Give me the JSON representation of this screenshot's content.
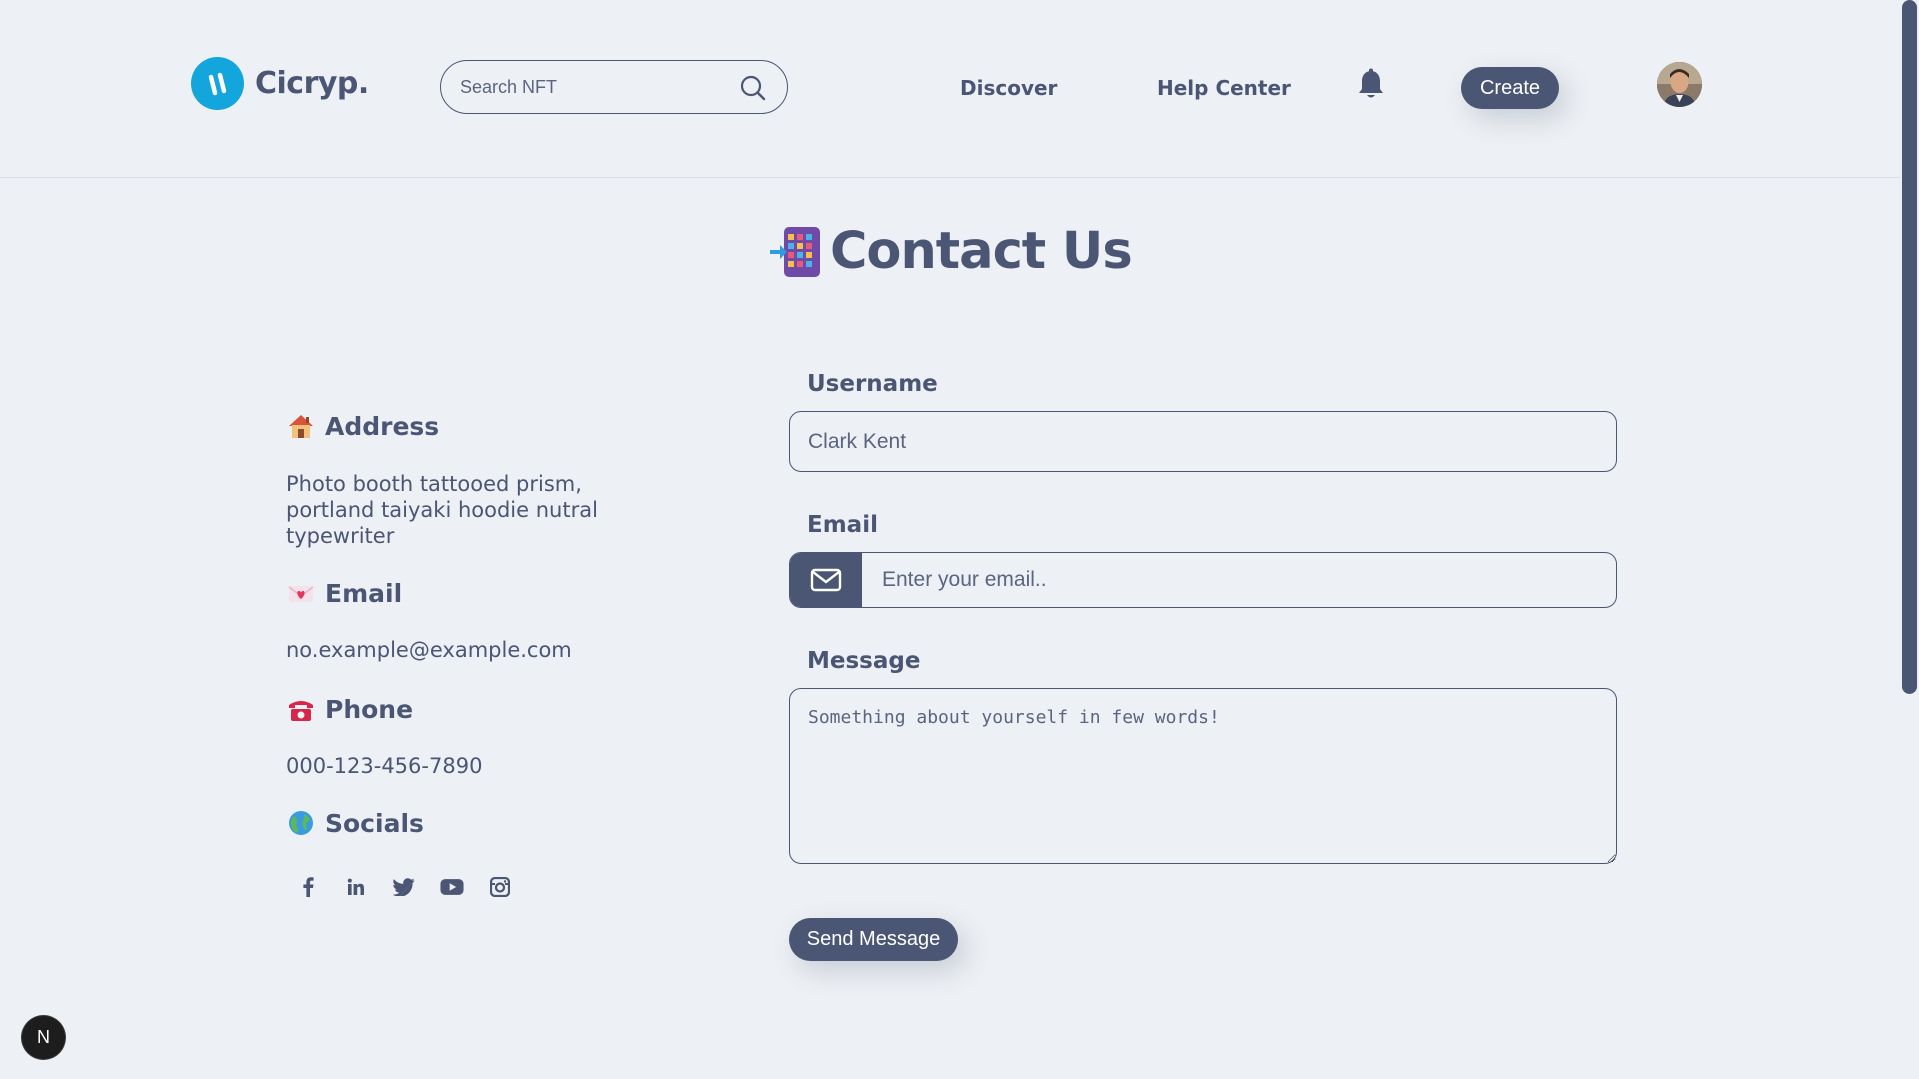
{
  "header": {
    "brand": "Cicryp.",
    "search_placeholder": "Search NFT",
    "nav": [
      "Discover",
      "Help Center"
    ],
    "create_label": "Create"
  },
  "page": {
    "title": "Contact Us"
  },
  "info": {
    "address_title": "Address",
    "address_text": "Photo booth tattooed prism, portland taiyaki hoodie nutral typewriter",
    "email_title": "Email",
    "email_value": "no.example@example.com",
    "phone_title": "Phone",
    "phone_value": "000-123-456-7890",
    "socials_title": "Socials",
    "socials": [
      "facebook-icon",
      "linkedin-icon",
      "twitter-icon",
      "youtube-icon",
      "instagram-icon"
    ]
  },
  "form": {
    "username_label": "Username",
    "username_placeholder": "Clark Kent",
    "email_label": "Email",
    "email_placeholder": "Enter your email..",
    "message_label": "Message",
    "message_placeholder": "Something about yourself in few words!",
    "submit_label": "Send Message"
  },
  "badge": {
    "letter": "N"
  },
  "colors": {
    "background": "#edf0f4",
    "primary": "#4b5574",
    "logo": "#12a6dc"
  }
}
